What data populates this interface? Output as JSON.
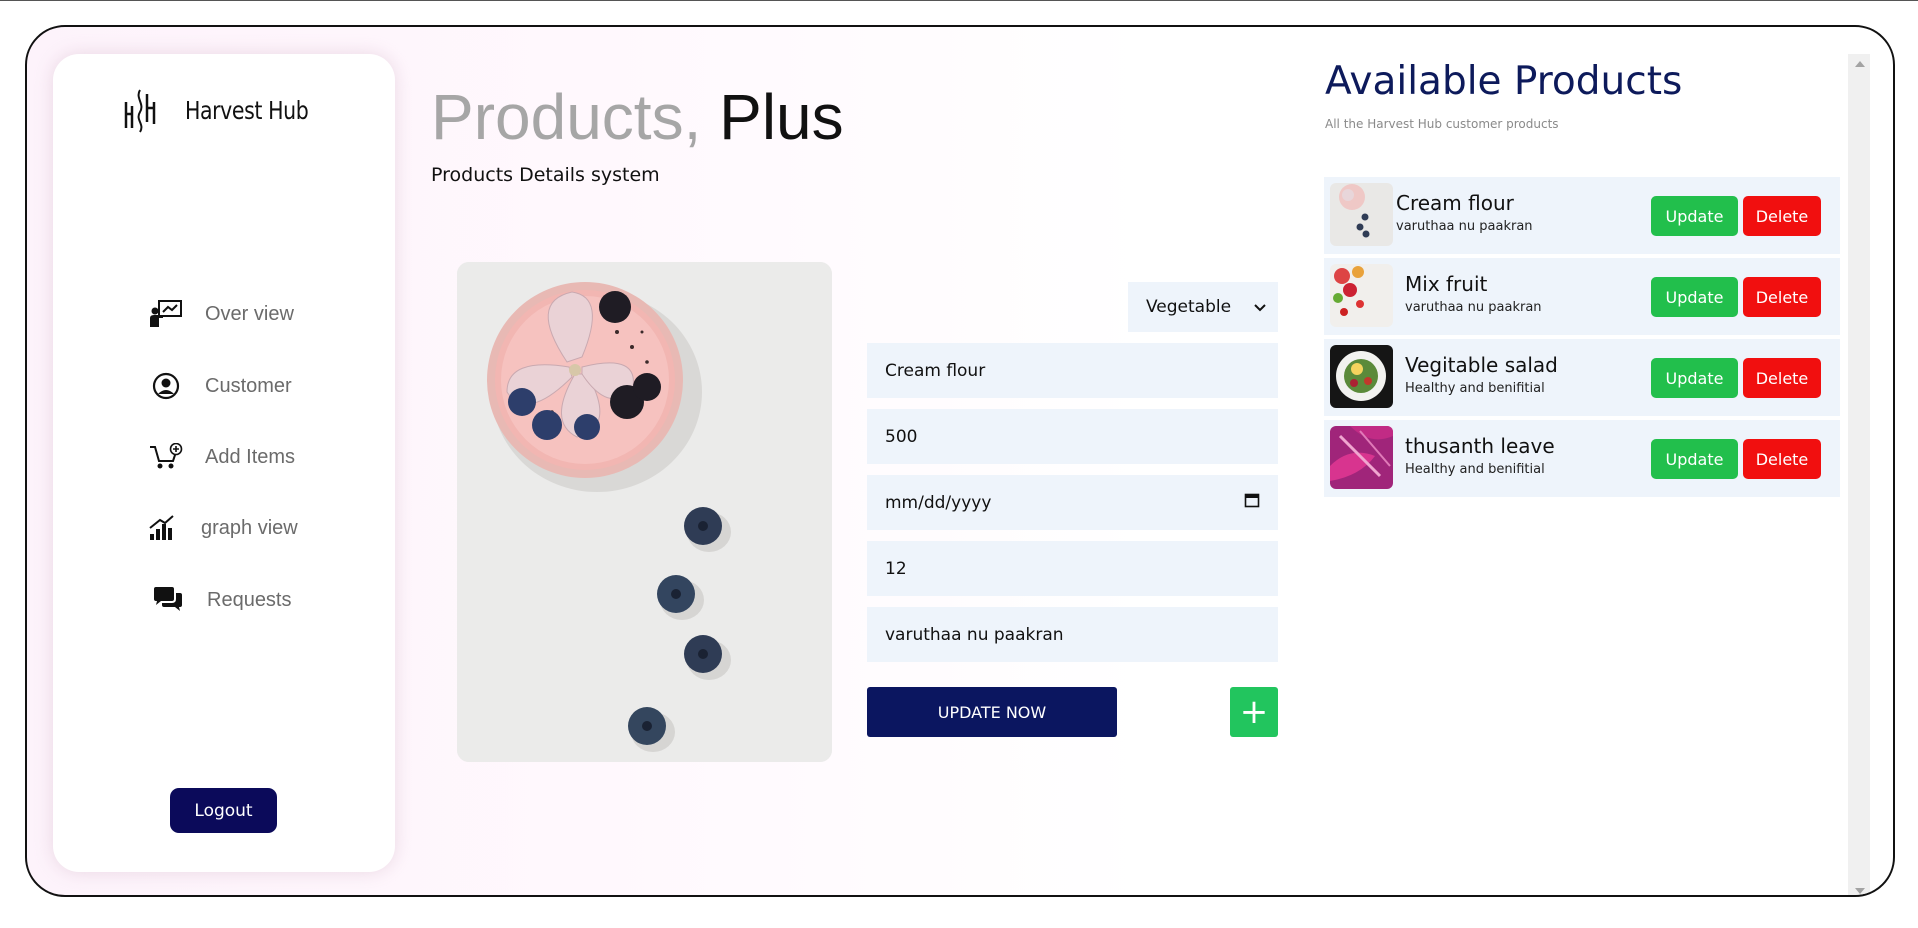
{
  "brand": {
    "name": "Harvest Hub",
    "logo_icon": "harvest-hub-logo"
  },
  "sidebar": {
    "items": [
      {
        "label": "Over view",
        "icon": "presentation-icon"
      },
      {
        "label": "Customer",
        "icon": "user-circle-icon"
      },
      {
        "label": "Add Items",
        "icon": "cart-plus-icon"
      },
      {
        "label": "graph view",
        "icon": "bar-chart-icon"
      },
      {
        "label": "Requests",
        "icon": "chat-icon"
      }
    ],
    "logout_label": "Logout"
  },
  "header": {
    "title_part1": "Products,",
    "title_part2": "Plus",
    "subtitle": "Products Details system"
  },
  "form": {
    "category_selected": "Vegetable",
    "name_value": "Cream flour",
    "quantity_value": "500",
    "date_value": "mm/dd/yyyy",
    "price_value": "12",
    "description_value": "varuthaa nu paakran",
    "submit_label": "UPDATE NOW",
    "add_label": "+"
  },
  "available": {
    "title": "Available Products",
    "subtitle": "All the Harvest Hub customer products",
    "products": [
      {
        "name": "Cream flour",
        "desc": "varuthaa nu paakran",
        "thumb": "cream-flour-thumb"
      },
      {
        "name": "Mix fruit",
        "desc": "varuthaa nu paakran",
        "thumb": "mix-fruit-thumb"
      },
      {
        "name": "Vegitable salad",
        "desc": "Healthy and benifitial",
        "thumb": "salad-thumb"
      },
      {
        "name": "thusanth leave",
        "desc": "Healthy and benifitial",
        "thumb": "leaves-thumb"
      }
    ],
    "update_label": "Update",
    "delete_label": "Delete"
  },
  "colors": {
    "brand_navy": "#0b0a5a",
    "accent_green": "#22bf4c",
    "danger_red": "#f10f0f",
    "field_bg": "#eef4fb"
  }
}
